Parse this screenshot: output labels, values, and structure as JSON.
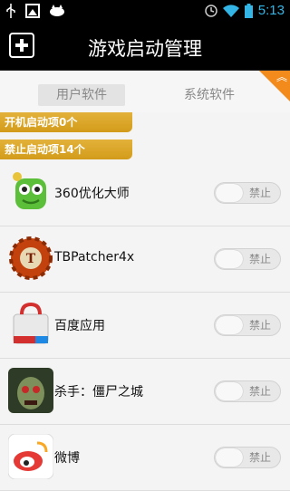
{
  "status_bar": {
    "time": "5:13",
    "icons": [
      "usb-icon",
      "image-icon",
      "cat-icon",
      "alarm-icon",
      "wifi-icon",
      "battery-icon"
    ]
  },
  "title_bar": {
    "title": "游戏启动管理",
    "add_icon": "plus-icon"
  },
  "tabs": [
    {
      "label": "用户软件",
      "active": true
    },
    {
      "label": "系统软件",
      "active": false
    }
  ],
  "banners": {
    "enabled": "开机启动项0个",
    "disabled": "禁止启动项14个"
  },
  "apps": [
    {
      "name": "360优化大师",
      "toggle_label": "禁止",
      "icon": "robot-app-icon"
    },
    {
      "name": "TBPatcher4x",
      "toggle_label": "禁止",
      "icon": "gear-badge-app-icon"
    },
    {
      "name": "百度应用",
      "toggle_label": "禁止",
      "icon": "shopping-bag-app-icon"
    },
    {
      "name": "杀手：僵尸之城",
      "toggle_label": "禁止",
      "icon": "zombie-app-icon"
    },
    {
      "name": "微博",
      "toggle_label": "禁止",
      "icon": "weibo-app-icon"
    }
  ],
  "colors": {
    "status_time": "#33b5e5",
    "accent_orange": "#f28a1c",
    "banner_gold": "#d9a426"
  }
}
